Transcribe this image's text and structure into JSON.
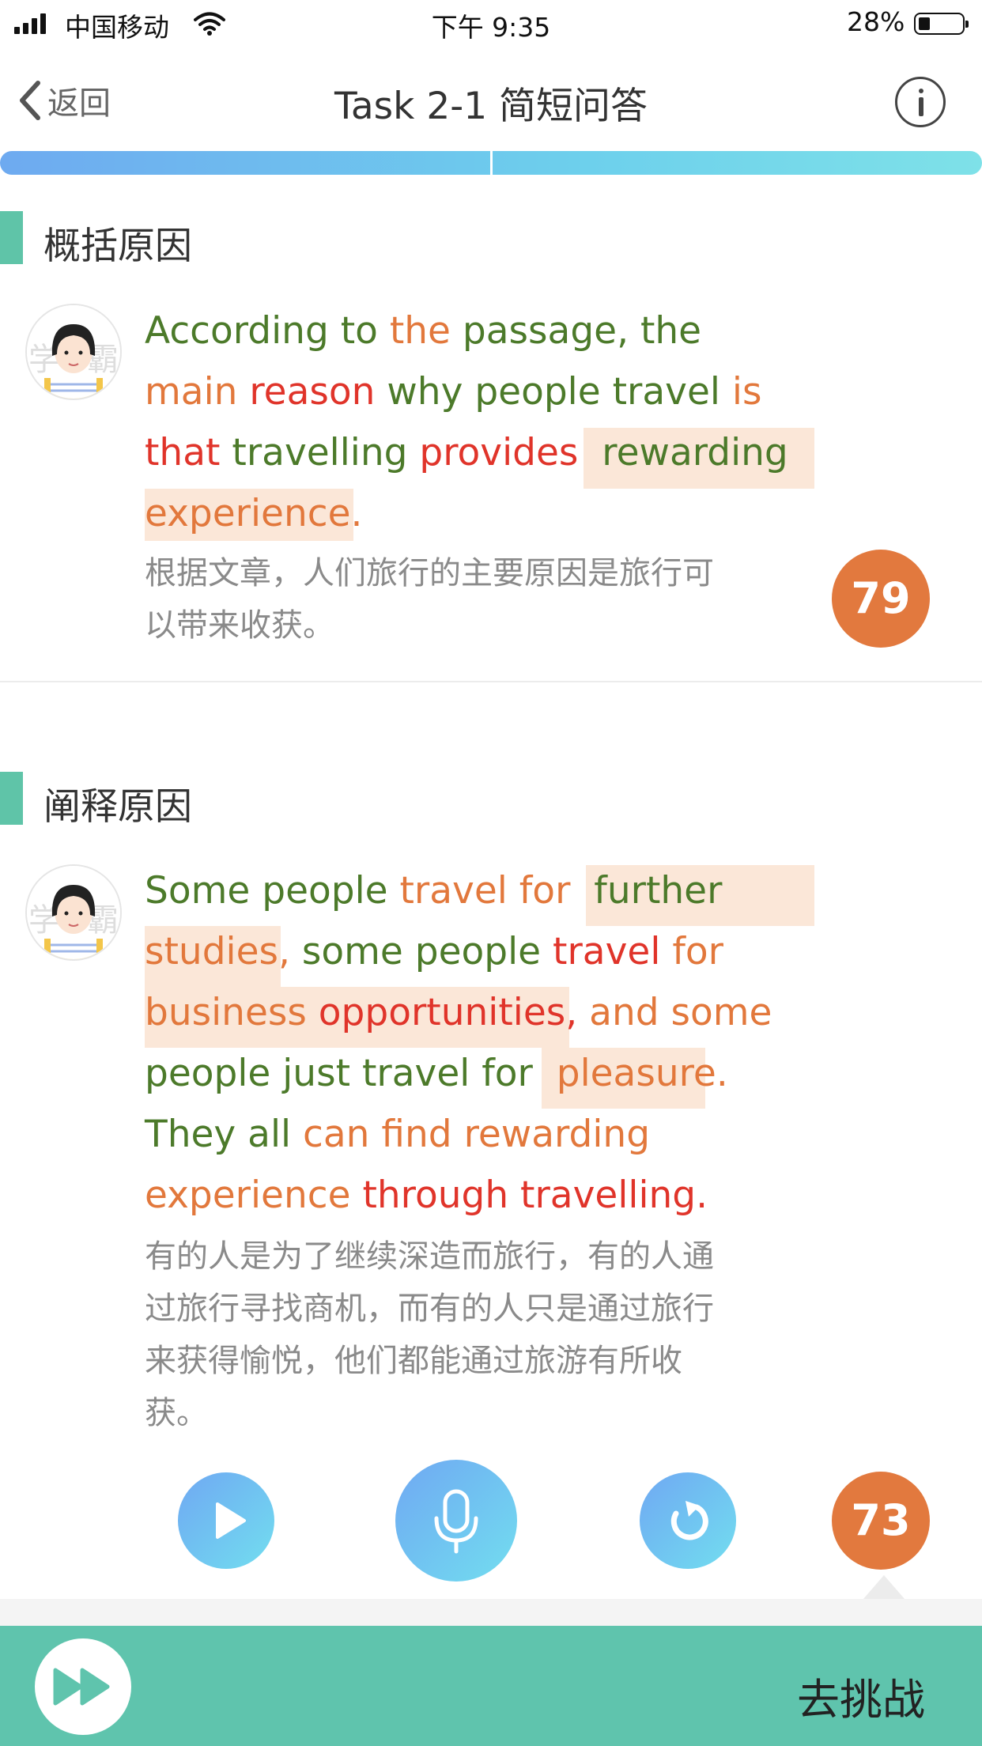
{
  "status_bar": {
    "carrier": "中国移动",
    "time": "下午 9:35",
    "battery": "28%"
  },
  "nav": {
    "back_label": "返回",
    "title": "Task 2-1 简短问答"
  },
  "colors": {
    "accent_green": "#5fc4ad",
    "score_orange": "#e2793e",
    "word_good": "#4c7a2a",
    "word_fair": "#e2783c",
    "word_poor": "#e0342a",
    "highlight": "#fbe7d8"
  },
  "sections": [
    {
      "title": "概括原因",
      "english": "According to the passage, the main reason why people travel is that travelling provides rewarding experience.",
      "chinese_line1": "根据文章，人们旅行的主要原因是旅行可",
      "chinese_line2": "以带来收获。",
      "score": "79"
    },
    {
      "title": "阐释原因",
      "english": "Some people travel for further studies, some people travel for business opportunities, and some people just travel for pleasure. They all can find rewarding experience through travelling.",
      "chinese_line1": "有的人是为了继续深造而旅行，有的人通",
      "chinese_line2": "过旅行寻找商机，而有的人只是通过旅行",
      "chinese_line3": "来获得愉悦，他们都能通过旅游有所收",
      "chinese_line4": "获。",
      "score": "73"
    }
  ],
  "controls": {
    "play_icon": "play-icon",
    "mic_icon": "microphone-icon",
    "retry_icon": "refresh-icon"
  },
  "bottom": {
    "challenge_label": "去挑战",
    "fast_forward_icon": "fast-forward-icon"
  }
}
